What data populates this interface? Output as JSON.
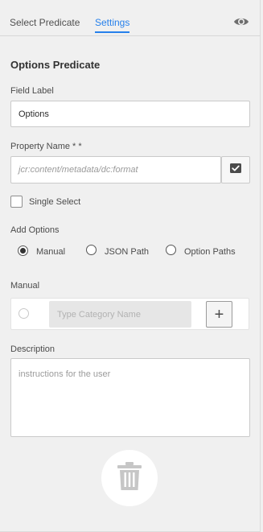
{
  "tabs": {
    "select_predicate": "Select Predicate",
    "settings": "Settings"
  },
  "section_title": "Options Predicate",
  "field_label": {
    "label": "Field Label",
    "value": "Options"
  },
  "property_name": {
    "label": "Property Name * *",
    "placeholder": "jcr:content/metadata/dc:format"
  },
  "single_select": {
    "label": "Single Select",
    "checked": false
  },
  "add_options": {
    "label": "Add Options",
    "options": [
      {
        "label": "Manual",
        "checked": true
      },
      {
        "label": "JSON Path",
        "checked": false
      },
      {
        "label": "Option Paths",
        "checked": false
      }
    ]
  },
  "manual": {
    "label": "Manual",
    "placeholder": "Type Category Name",
    "add_label": "+"
  },
  "description": {
    "label": "Description",
    "placeholder": "instructions for the user"
  },
  "colors": {
    "accent": "#2680eb",
    "panel_bg": "#f0f0f0"
  },
  "icons": [
    "eye-icon",
    "checkmark-icon",
    "plus-icon",
    "trash-icon"
  ]
}
